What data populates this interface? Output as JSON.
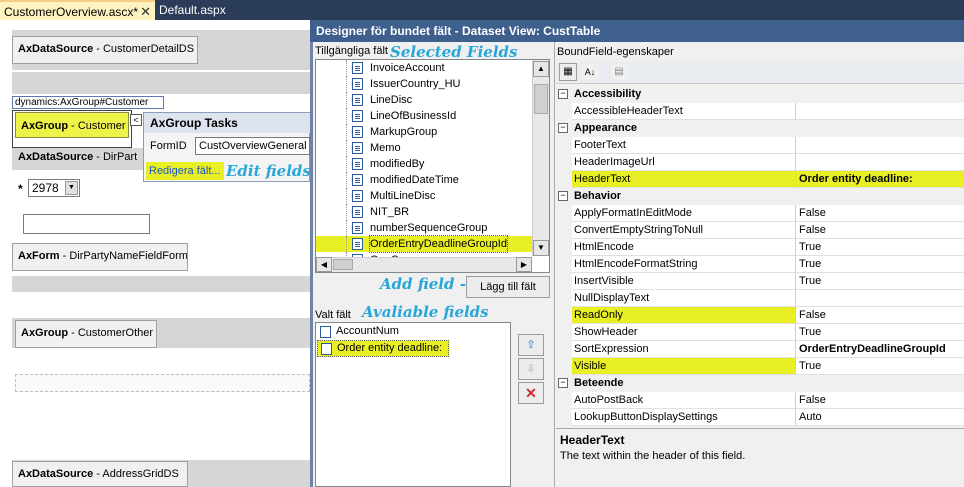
{
  "tabs": [
    {
      "label": "CustomerOverview.ascx*",
      "close": "✕"
    },
    {
      "label": "Default.aspx"
    }
  ],
  "left": {
    "ds_customer": {
      "type": "AxDataSource",
      "name": " - CustomerDetailDS"
    },
    "group_tag": "dynamics:AxGroup#Customer",
    "group_customer": {
      "type": "AxGroup",
      "name": " - Customer"
    },
    "ds_dirpart": {
      "type": "AxDataSource",
      "name": " - DirPart"
    },
    "combo_value": "2978",
    "star": "*",
    "form": {
      "type": "AxForm",
      "name": " - DirPartyNameFieldForm"
    },
    "group_other": {
      "type": "AxGroup",
      "name": " - CustomerOther"
    },
    "ds_address": {
      "type": "AxDataSource",
      "name": " - AddressGridDS"
    }
  },
  "tasks": {
    "title": "AxGroup Tasks",
    "formid_label": "FormID",
    "formid_value": "CustOverviewGeneral",
    "edit_link": "Redigera fält...",
    "edit_annotation": "Edit fields",
    "collapse": "<"
  },
  "dialog": {
    "title": "Designer för bundet fält - Dataset View: CustTable",
    "available_label": "Tillgängliga fält",
    "available_annotation": "Selected Fields",
    "available_items": [
      "InvoiceAccount",
      "IssuerCountry_HU",
      "LineDisc",
      "LineOfBusinessId",
      "MarkupGroup",
      "Memo",
      "modifiedBy",
      "modifiedDateTime",
      "MultiLineDisc",
      "NIT_BR",
      "numberSequenceGroup",
      "OrderEntryDeadlineGroupId",
      "OneC..."
    ],
    "add_annotation": "Add field ->",
    "add_button": "Lägg till fält",
    "selected_label": "Valt fält",
    "selected_annotation": "Avaliable fields",
    "selected_items": [
      "AccountNum",
      "Order entity deadline:"
    ]
  },
  "props": {
    "header": "BoundField-egenskaper",
    "categories": [
      {
        "name": "Accessibility",
        "rows": [
          [
            "AccessibleHeaderText",
            ""
          ]
        ]
      },
      {
        "name": "Appearance",
        "rows": [
          [
            "FooterText",
            ""
          ],
          [
            "HeaderImageUrl",
            ""
          ],
          [
            "HeaderText",
            "Order entity deadline:"
          ]
        ]
      },
      {
        "name": "Behavior",
        "rows": [
          [
            "ApplyFormatInEditMode",
            "False"
          ],
          [
            "ConvertEmptyStringToNull",
            "False"
          ],
          [
            "HtmlEncode",
            "True"
          ],
          [
            "HtmlEncodeFormatString",
            "True"
          ],
          [
            "InsertVisible",
            "True"
          ],
          [
            "NullDisplayText",
            ""
          ],
          [
            "ReadOnly",
            "False"
          ],
          [
            "ShowHeader",
            "True"
          ],
          [
            "SortExpression",
            "OrderEntryDeadlineGroupId"
          ],
          [
            "Visible",
            "True"
          ]
        ]
      },
      {
        "name": "Beteende",
        "rows": [
          [
            "AutoPostBack",
            "False"
          ],
          [
            "LookupButtonDisplaySettings",
            "Auto"
          ]
        ]
      }
    ],
    "desc_title": "HeaderText",
    "desc_text": "The text within the header of this field."
  },
  "colors": {
    "highlight": "#e8f025",
    "annotation": "#27a6d8",
    "titlebar": "#3f5f8c"
  }
}
